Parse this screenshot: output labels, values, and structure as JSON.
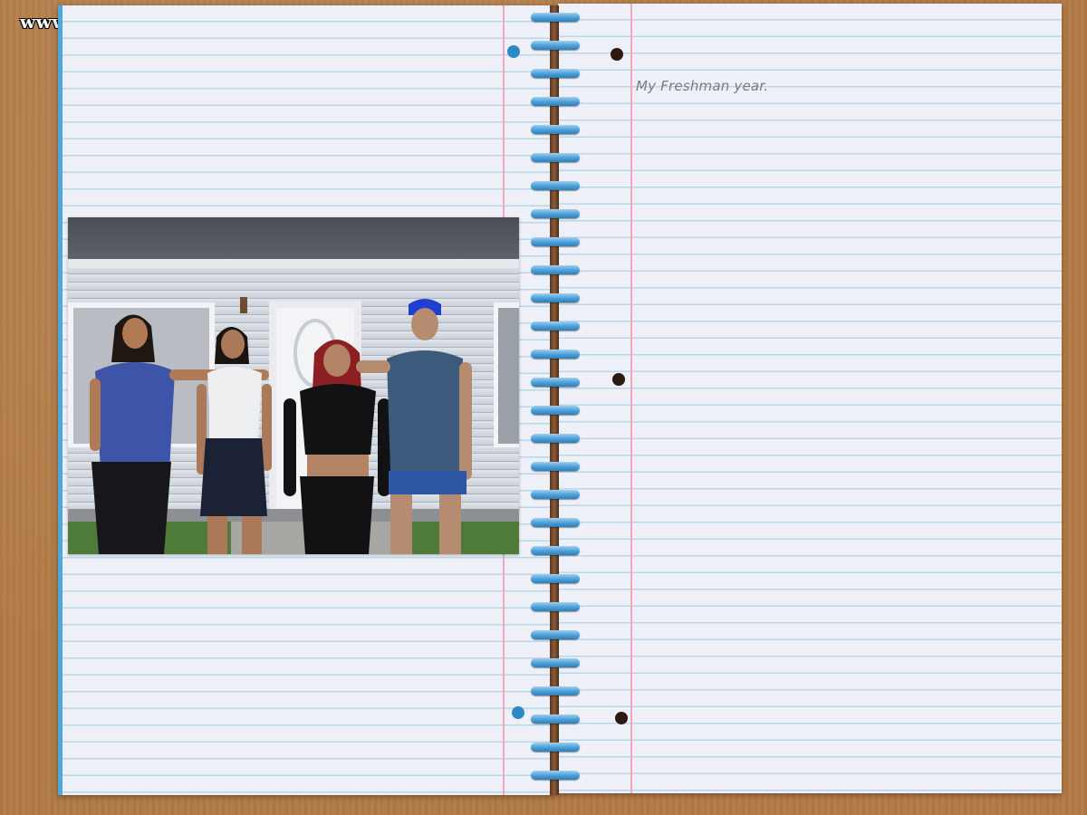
{
  "watermark": {
    "text": "www.erofus.com"
  },
  "notebook": {
    "note_text": "My Freshman year.",
    "colors": {
      "paper": "#eef0f7",
      "rule_line": "#b9d6ea",
      "margin_line": "#f2a8b8",
      "binder_edge": "#4fa8dc",
      "coil": "#4a9ed6",
      "desk": "#b27b47"
    }
  },
  "photo": {
    "description_icon": "group-photo-house"
  }
}
